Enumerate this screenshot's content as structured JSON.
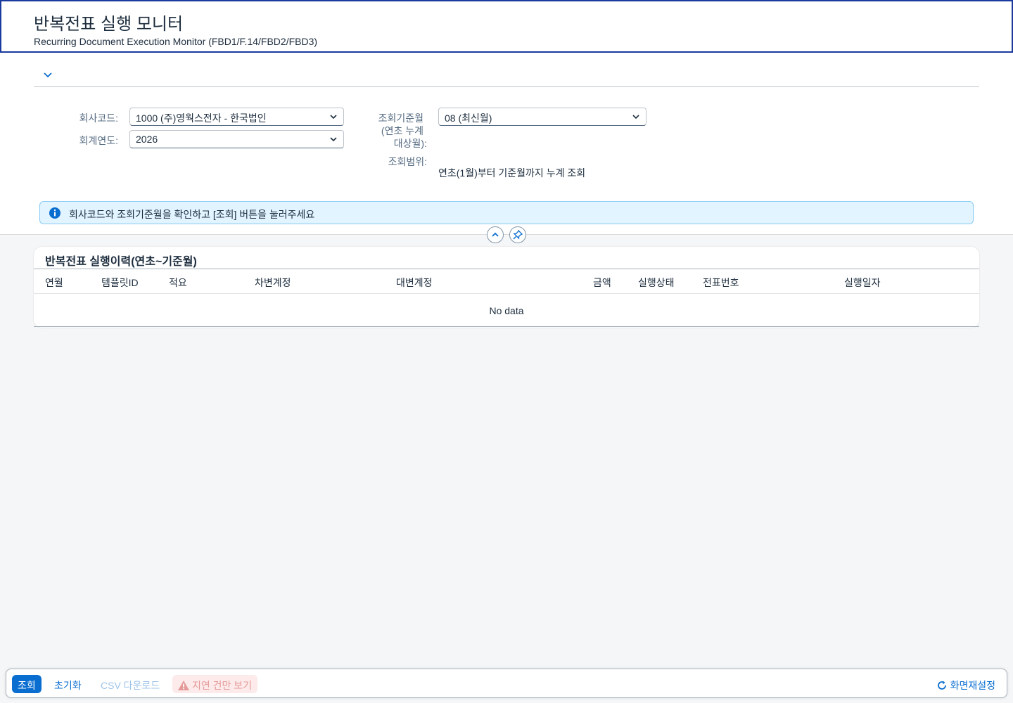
{
  "header": {
    "title": "반복전표 실행 모니터",
    "subtitle": "Recurring Document Execution Monitor (FBD1/F.14/FBD2/FBD3)"
  },
  "filters": {
    "company_label": "회사코드:",
    "company_value": "1000 (주)영웍스전자 - 한국법인",
    "year_label": "회계연도:",
    "year_value": "2026",
    "month_label_line1": "조회기준월",
    "month_label_line2": "(연초 누계",
    "month_label_line3": "대상월):",
    "month_value": "08 (최신월)",
    "range_label": "조회범위:",
    "range_value": "연초(1월)부터 기준월까지 누계 조회"
  },
  "message": {
    "text": "회사코드와 조회기준월을 확인하고 [조회] 버튼을 눌러주세요"
  },
  "table": {
    "title": "반복전표 실행이력(연초~기준월)",
    "columns": [
      "연월",
      "템플릿ID",
      "적요",
      "차변계정",
      "대변계정",
      "금액",
      "실행상태",
      "전표번호",
      "실행일자"
    ],
    "empty_text": "No data"
  },
  "footer": {
    "search_label": "조회",
    "reset_label": "초기화",
    "csv_label": "CSV 다운로드",
    "delayed_label": "지연 건만 보기",
    "screen_reset_label": "화면재설정"
  },
  "colors": {
    "accent": "#0a6ed1",
    "header_border": "#1a3a9e",
    "info_bg": "#e1f4ff",
    "warn_bg": "#fdeaea"
  },
  "icons": [
    "chevron-down-icon",
    "info-icon",
    "chevron-up-icon",
    "pin-icon",
    "warning-icon",
    "refresh-icon"
  ]
}
